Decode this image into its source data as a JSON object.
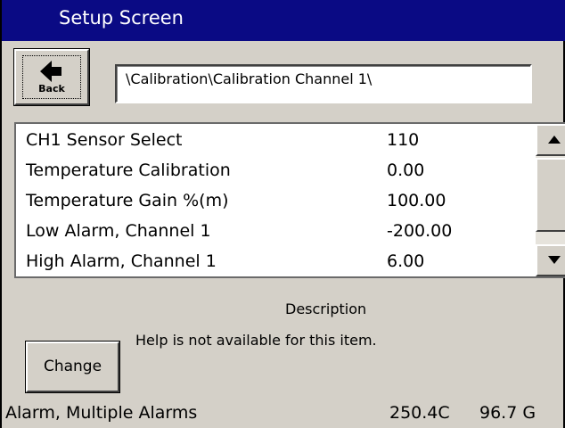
{
  "window": {
    "title": "Setup Screen"
  },
  "toolbar": {
    "back_label": "Back",
    "path": "\\Calibration\\Calibration Channel 1\\"
  },
  "settings": {
    "rows": [
      {
        "label": "CH1 Sensor Select",
        "value": "110"
      },
      {
        "label": "Temperature Calibration",
        "value": "0.00"
      },
      {
        "label": "Temperature Gain %(m)",
        "value": "100.00"
      },
      {
        "label": "Low Alarm, Channel 1",
        "value": "-200.00"
      },
      {
        "label": "High Alarm, Channel 1",
        "value": "6.00"
      }
    ]
  },
  "scrollbar": {
    "up_icon": "triangle-up-icon",
    "down_icon": "triangle-down-icon"
  },
  "description": {
    "heading": "Description",
    "text": "Help is not available for this item."
  },
  "actions": {
    "change_label": "Change"
  },
  "status": {
    "alarm": "Alarm, Multiple Alarms",
    "temperature": "250.4C",
    "gain": "96.7 G"
  },
  "colors": {
    "titlebar": "#0a0a84",
    "background": "#d4d0c8"
  }
}
